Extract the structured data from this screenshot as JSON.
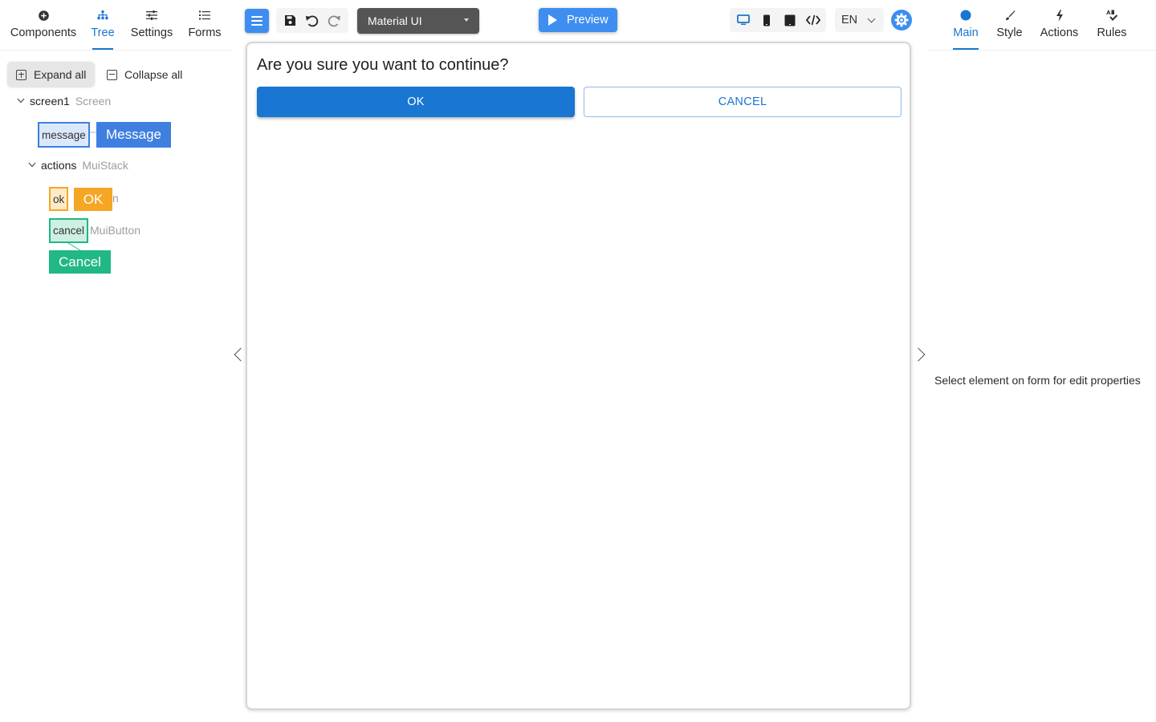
{
  "left_tabs": [
    {
      "label": "Components",
      "icon": "plus-circle-icon",
      "active": false
    },
    {
      "label": "Tree",
      "icon": "tree-icon",
      "active": true
    },
    {
      "label": "Settings",
      "icon": "sliders-icon",
      "active": false
    },
    {
      "label": "Forms",
      "icon": "list-icon",
      "active": false
    }
  ],
  "tree_actions": {
    "expand_label": "Expand all",
    "collapse_label": "Collapse all"
  },
  "tree": {
    "screen": {
      "name": "screen1",
      "type": "Screen"
    },
    "message": {
      "name": "message",
      "badge": "Message",
      "color": "#3f7fe0"
    },
    "actions": {
      "name": "actions",
      "type": "MuiStack"
    },
    "ok": {
      "name": "ok",
      "type_fragment": "n",
      "badge": "OK",
      "color": "#f5a623"
    },
    "cancel": {
      "name": "cancel",
      "type": "MuiButton",
      "badge": "Cancel",
      "color": "#20b884"
    }
  },
  "toolbar": {
    "library_select": "Material UI",
    "preview_label": "Preview",
    "language": "EN",
    "accent_color": "#3d8ef0"
  },
  "dialog": {
    "title": "Are you sure you want to continue?",
    "ok_label": "OK",
    "cancel_label": "CANCEL",
    "primary_color": "#1976d2"
  },
  "right_tabs": [
    {
      "label": "Main",
      "icon": "circle-icon",
      "active": true
    },
    {
      "label": "Style",
      "icon": "brush-icon",
      "active": false
    },
    {
      "label": "Actions",
      "icon": "lightning-icon",
      "active": false
    },
    {
      "label": "Rules",
      "icon": "rules-icon",
      "active": false
    }
  ],
  "properties_hint": "Select element on form for edit properties"
}
